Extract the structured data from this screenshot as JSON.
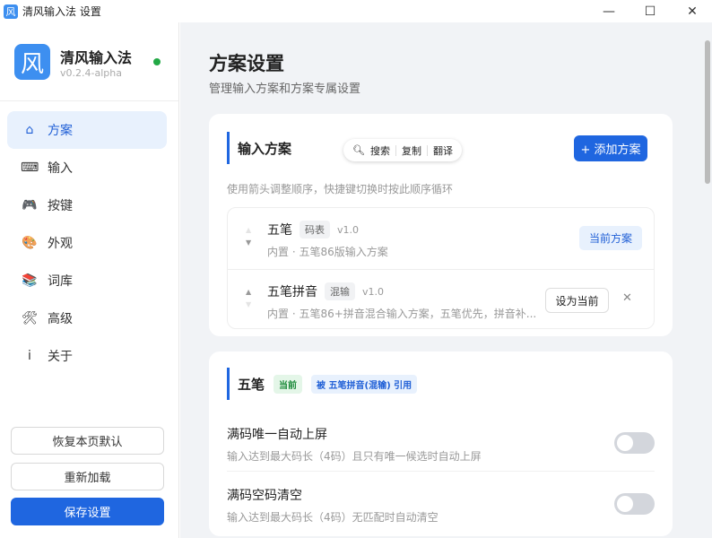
{
  "window": {
    "title": "清风输入法 设置",
    "icon": "风",
    "minimize": "—",
    "maximize": "☐",
    "close": "✕"
  },
  "brand": {
    "logo": "风",
    "name": "清风输入法",
    "version": "v0.2.4-alpha",
    "status_color": "#22a845"
  },
  "nav": [
    {
      "icon": "home-icon",
      "glyph": "⌂",
      "label": "方案"
    },
    {
      "icon": "keyboard-icon",
      "glyph": "⌨",
      "label": "输入"
    },
    {
      "icon": "gamepad-icon",
      "glyph": "🎮",
      "label": "按键"
    },
    {
      "icon": "palette-icon",
      "glyph": "🎨",
      "label": "外观"
    },
    {
      "icon": "books-icon",
      "glyph": "📚",
      "label": "词库"
    },
    {
      "icon": "tools-icon",
      "glyph": "🛠",
      "label": "高级"
    },
    {
      "icon": "info-icon",
      "glyph": "i",
      "label": "关于"
    }
  ],
  "sidebar_buttons": {
    "reset": "恢复本页默认",
    "reload": "重新加载",
    "save": "保存设置"
  },
  "page": {
    "title": "方案设置",
    "subtitle": "管理输入方案和方案专属设置"
  },
  "schemes": {
    "title": "输入方案",
    "toolbar": {
      "search": "搜索",
      "copy": "复制",
      "translate": "翻译"
    },
    "add_button": "+ 添加方案",
    "hint": "使用箭头调整顺序，快捷键切换时按此顺序循环",
    "items": [
      {
        "name": "五笔",
        "tag": "码表",
        "version": "v1.0",
        "desc": "内置 · 五笔86版输入方案",
        "status": "当前方案"
      },
      {
        "name": "五笔拼音",
        "tag": "混输",
        "version": "v1.0",
        "desc": "内置 · 五笔86+拼音混合输入方案，五笔优先，拼音补...",
        "action": "设为当前",
        "remove": "✕"
      }
    ]
  },
  "wubi": {
    "title": "五笔",
    "badge_current": "当前",
    "badge_ref": "被 五笔拼音(混输) 引用",
    "options": [
      {
        "title": "满码唯一自动上屏",
        "desc": "输入达到最大码长（4码）且只有唯一候选时自动上屏",
        "enabled": false
      },
      {
        "title": "满码空码清空",
        "desc": "输入达到最大码长（4码）无匹配时自动清空",
        "enabled": false
      }
    ]
  }
}
